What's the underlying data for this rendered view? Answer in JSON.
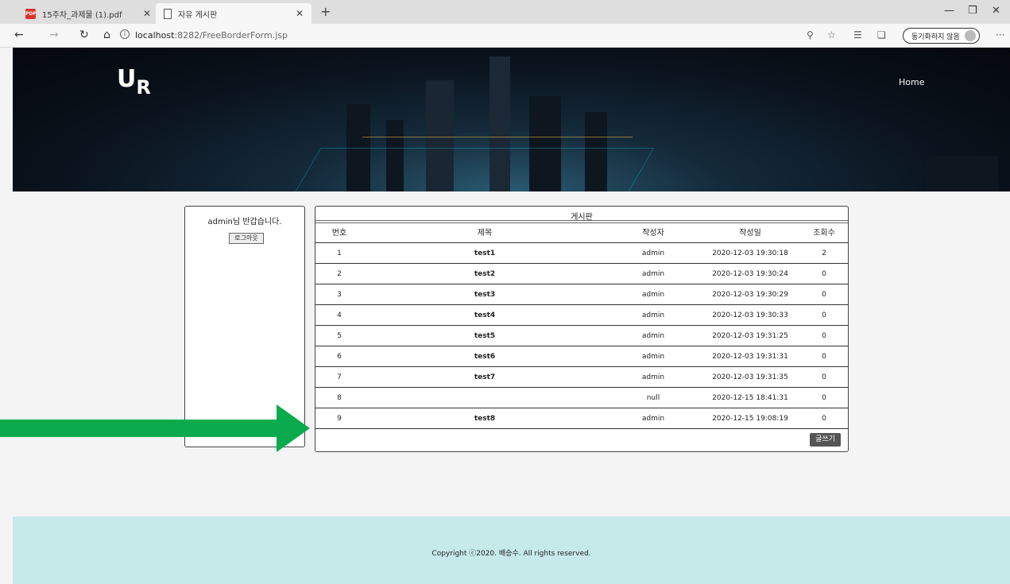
{
  "browser": {
    "tabs": [
      {
        "label": "15주차_과제물 (1).pdf",
        "icon": "pdf-icon"
      },
      {
        "label": "자유 게시판",
        "icon": "document-icon"
      }
    ],
    "address": {
      "host": "localhost",
      "path": ":8282/FreeBorderForm.jsp"
    },
    "sync_label": "동기화하지 않음"
  },
  "header": {
    "logo_main": "U",
    "logo_sub": "R",
    "nav_home": "Home"
  },
  "login": {
    "welcome": "admin님 반갑습니다.",
    "logout": "로그아웃"
  },
  "board": {
    "title": "게시판",
    "columns": {
      "no": "번호",
      "title": "제목",
      "writer": "작성자",
      "date": "작성일",
      "hits": "조회수"
    },
    "rows": [
      {
        "no": "1",
        "title": "test1",
        "writer": "admin",
        "date": "2020-12-03 19:30:18",
        "hits": "2"
      },
      {
        "no": "2",
        "title": "test2",
        "writer": "admin",
        "date": "2020-12-03 19:30:24",
        "hits": "0"
      },
      {
        "no": "3",
        "title": "test3",
        "writer": "admin",
        "date": "2020-12-03 19:30:29",
        "hits": "0"
      },
      {
        "no": "4",
        "title": "test4",
        "writer": "admin",
        "date": "2020-12-03 19:30:33",
        "hits": "0"
      },
      {
        "no": "5",
        "title": "test5",
        "writer": "admin",
        "date": "2020-12-03 19:31:25",
        "hits": "0"
      },
      {
        "no": "6",
        "title": "test6",
        "writer": "admin",
        "date": "2020-12-03 19:31:31",
        "hits": "0"
      },
      {
        "no": "7",
        "title": "test7",
        "writer": "admin",
        "date": "2020-12-03 19:31:35",
        "hits": "0"
      },
      {
        "no": "8",
        "title": "",
        "writer": "null",
        "date": "2020-12-15 18:41:31",
        "hits": "0"
      },
      {
        "no": "9",
        "title": "test8",
        "writer": "admin",
        "date": "2020-12-15 19:08:19",
        "hits": "0"
      }
    ],
    "write_button": "글쓰기"
  },
  "footer": {
    "copyright": "Copyright ⓒ2020. 배승수. All rights reserved."
  },
  "colors": {
    "arrow": "#0bab4d",
    "footer_bg": "#c6e9ea"
  }
}
